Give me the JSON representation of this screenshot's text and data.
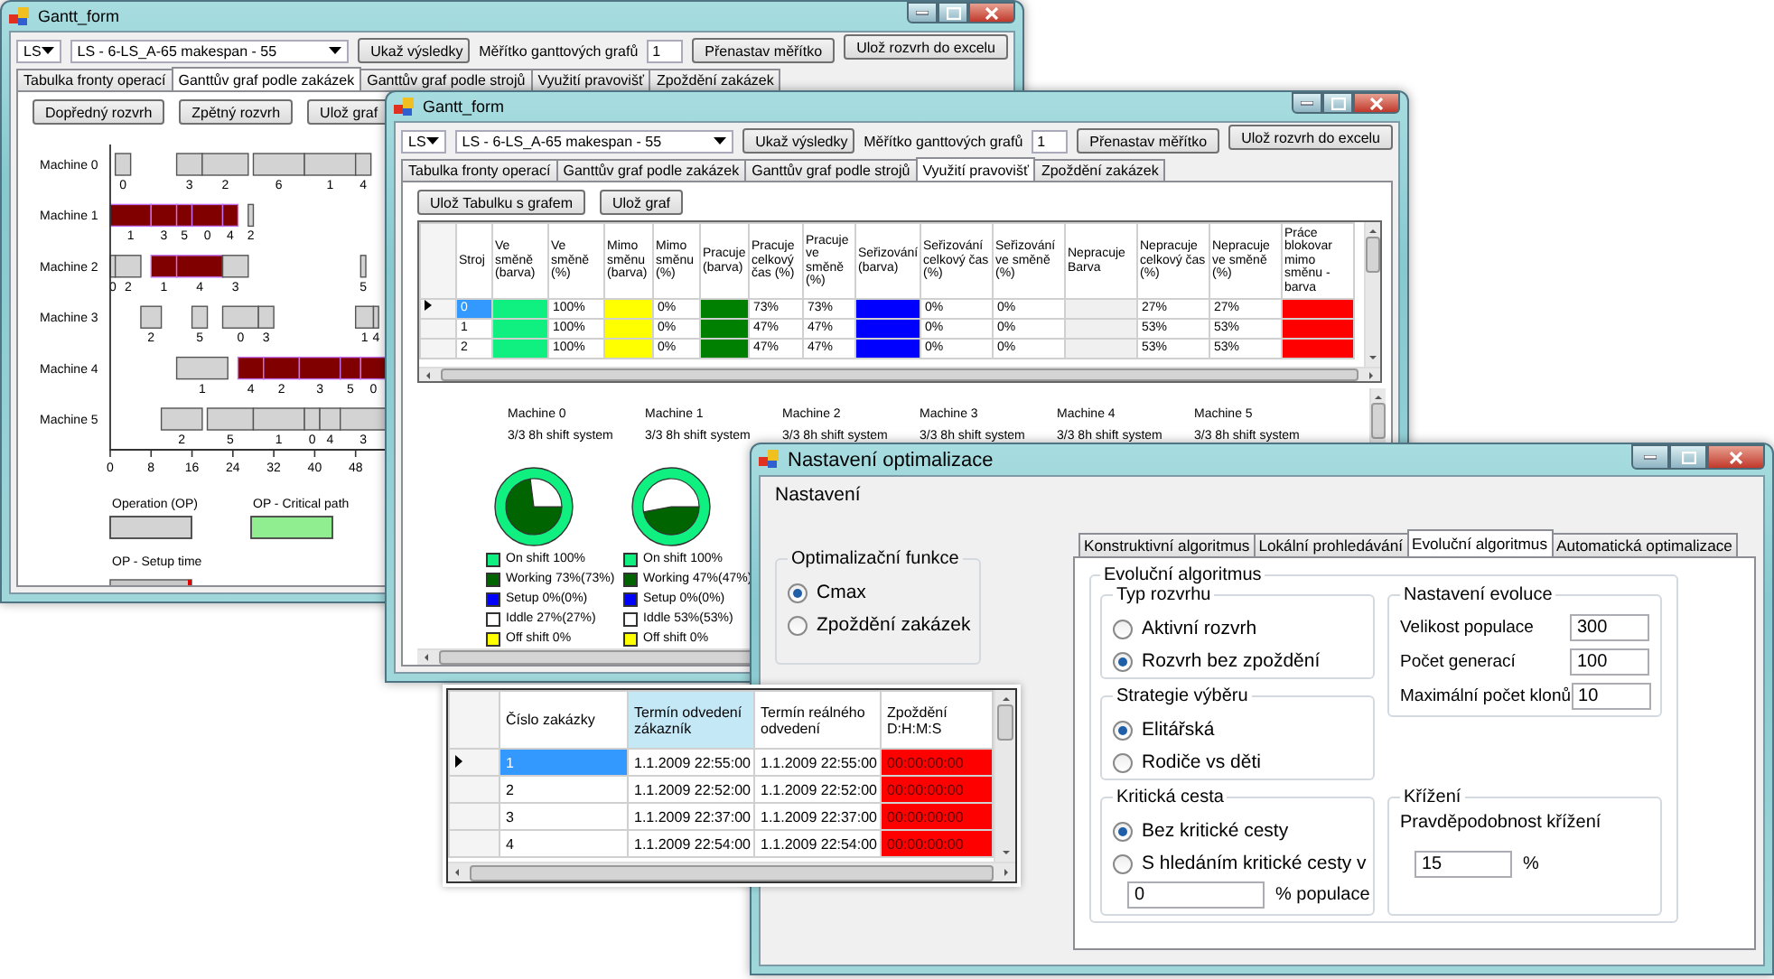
{
  "gantt_window": {
    "title": "Gantt_form",
    "algorithm_combo": "LS",
    "schedule_combo": "LS - 6-LS_A-65 makespan - 55",
    "show_results_button": "Ukaž výsledky",
    "scale_label": "Měřítko ganttových grafů",
    "scale_value": "1",
    "rescale_button": "Přenastav měřítko",
    "export_button": "Ulož rozvrh do excelu",
    "tabs": [
      {
        "label": "Tabulka fronty operací",
        "selected": false
      },
      {
        "label": "Ganttův graf podle zakázek",
        "selected": true
      },
      {
        "label": "Ganttův graf podle strojů",
        "selected": false
      },
      {
        "label": "Využití pravovišť",
        "selected": false
      },
      {
        "label": "Zpoždění zakázek",
        "selected": false
      }
    ],
    "buttons": [
      "Dopředný rozvrh",
      "Zpětný rozvrh",
      "Ulož graf"
    ],
    "gantt": {
      "ticks": [
        "0",
        "8",
        "16",
        "24",
        "32",
        "40",
        "48"
      ],
      "machines": [
        {
          "name": "Machine 0",
          "operations": [
            {
              "label": "0",
              "critical": false
            },
            {
              "label": "3",
              "critical": false
            },
            {
              "label": "2",
              "critical": false
            },
            {
              "label": "6",
              "critical": false
            },
            {
              "label": "1",
              "critical": false
            },
            {
              "label": "4",
              "critical": false
            }
          ]
        },
        {
          "name": "Machine 1",
          "operations": [
            {
              "label": "1",
              "critical": true
            },
            {
              "label": "3",
              "critical": true
            },
            {
              "label": "5",
              "critical": true
            },
            {
              "label": "0",
              "critical": true
            },
            {
              "label": "4",
              "critical": true
            },
            {
              "label": "2",
              "critical": false
            }
          ]
        },
        {
          "name": "Machine 2",
          "operations": [
            {
              "label": "0",
              "critical": false
            },
            {
              "label": "2",
              "critical": false
            },
            {
              "label": "1",
              "critical": true
            },
            {
              "label": "4",
              "critical": true
            },
            {
              "label": "3",
              "critical": false
            },
            {
              "label": "5",
              "critical": false
            }
          ]
        },
        {
          "name": "Machine 3",
          "operations": [
            {
              "label": "2",
              "critical": false
            },
            {
              "label": "5",
              "critical": false
            },
            {
              "label": "0",
              "critical": false
            },
            {
              "label": "3",
              "critical": false
            },
            {
              "label": "1",
              "critical": false
            },
            {
              "label": "4",
              "critical": false
            }
          ]
        },
        {
          "name": "Machine 4",
          "operations": [
            {
              "label": "1",
              "critical": false
            },
            {
              "label": "4",
              "critical": true
            },
            {
              "label": "2",
              "critical": true
            },
            {
              "label": "3",
              "critical": true
            },
            {
              "label": "5",
              "critical": true
            },
            {
              "label": "0",
              "critical": true
            }
          ]
        },
        {
          "name": "Machine 5",
          "operations": [
            {
              "label": "2",
              "critical": false
            },
            {
              "label": "5",
              "critical": false
            },
            {
              "label": "1",
              "critical": false
            },
            {
              "label": "0",
              "critical": false
            },
            {
              "label": "4",
              "critical": false
            },
            {
              "label": "3",
              "critical": false
            }
          ]
        }
      ],
      "legend": [
        {
          "label": "Operation (OP)",
          "kind": "operation"
        },
        {
          "label": "OP - Critical path",
          "kind": "critical"
        },
        {
          "label": "OP - Setup time",
          "kind": "setup"
        }
      ]
    }
  },
  "utilization_window": {
    "title": "Gantt_form",
    "algorithm_combo": "LS",
    "schedule_combo": "LS - 6-LS_A-65 makespan - 55",
    "show_results_button": "Ukaž výsledky",
    "scale_label": "Měřítko ganttových grafů",
    "scale_value": "1",
    "rescale_button": "Přenastav měřítko",
    "export_button": "Ulož rozvrh do excelu",
    "tabs": [
      {
        "label": "Tabulka fronty operací",
        "selected": false
      },
      {
        "label": "Ganttův graf podle zakázek",
        "selected": false
      },
      {
        "label": "Ganttův graf podle strojů",
        "selected": false
      },
      {
        "label": "Využití pravovišť",
        "selected": true
      },
      {
        "label": "Zpoždění zakázek",
        "selected": false
      }
    ],
    "buttons": [
      "Ulož Tabulku s grafem",
      "Ulož graf"
    ],
    "grid": {
      "columns": [
        {
          "label": "Stroj",
          "kind": "text"
        },
        {
          "label": "Ve směně (barva)",
          "kind": "color"
        },
        {
          "label": "Ve směně (%)",
          "kind": "text"
        },
        {
          "label": "Mimo směnu (barva)",
          "kind": "color"
        },
        {
          "label": "Mimo směnu (%)",
          "kind": "text"
        },
        {
          "label": "Pracuje (barva)",
          "kind": "color"
        },
        {
          "label": "Pracuje celkový čas (%)",
          "kind": "text"
        },
        {
          "label": "Pracuje ve směně (%)",
          "kind": "text"
        },
        {
          "label": "Seřizování (barva)",
          "kind": "color"
        },
        {
          "label": "Seřizování celkový čas (%)",
          "kind": "text"
        },
        {
          "label": "Seřizování ve směně (%)",
          "kind": "text"
        },
        {
          "label": "Nepracuje Barva",
          "kind": "color"
        },
        {
          "label": "Nepracuje celkový čas (%)",
          "kind": "text"
        },
        {
          "label": "Nepracuje ve směně (%)",
          "kind": "text"
        },
        {
          "label": "Práce blokovar mimo směnu - barva",
          "kind": "color"
        }
      ],
      "rows": [
        {
          "selected": true,
          "cells": [
            "0",
            {
              "color": "#10f080"
            },
            "100%",
            {
              "color": "#ffff00"
            },
            "0%",
            {
              "color": "#008000"
            },
            "73%",
            "73%",
            {
              "color": "#0000ff"
            },
            "0%",
            "0%",
            {
              "color": "#f0f0f0"
            },
            "27%",
            "27%",
            {
              "color": "#ff0000"
            }
          ]
        },
        {
          "selected": false,
          "cells": [
            "1",
            {
              "color": "#10f080"
            },
            "100%",
            {
              "color": "#ffff00"
            },
            "0%",
            {
              "color": "#008000"
            },
            "47%",
            "47%",
            {
              "color": "#0000ff"
            },
            "0%",
            "0%",
            {
              "color": "#f0f0f0"
            },
            "53%",
            "53%",
            {
              "color": "#ff0000"
            }
          ]
        },
        {
          "selected": false,
          "cells": [
            "2",
            {
              "color": "#10f080"
            },
            "100%",
            {
              "color": "#ffff00"
            },
            "0%",
            {
              "color": "#008000"
            },
            "47%",
            "47%",
            {
              "color": "#0000ff"
            },
            "0%",
            "0%",
            {
              "color": "#f0f0f0"
            },
            "53%",
            "53%",
            {
              "color": "#ff0000"
            }
          ]
        }
      ]
    },
    "machines": [
      {
        "name": "Machine 0",
        "shift": "3/3 8h shift system",
        "pie": {
          "chart_data": {
            "type": "pie",
            "values": [
              73,
              27
            ]
          },
          "legend": [
            {
              "label": "On shift 100%",
              "color": "#10f080"
            },
            {
              "label": "Working 73%(73%)",
              "color": "#006400"
            },
            {
              "label": "Setup 0%(0%)",
              "color": "#0000ff"
            },
            {
              "label": "Iddle 27%(27%)",
              "color": "#ffffff"
            },
            {
              "label": "Off shift 0%",
              "color": "#ffff00"
            }
          ]
        }
      },
      {
        "name": "Machine 1",
        "shift": "3/3 8h shift system",
        "pie": {
          "chart_data": {
            "type": "pie",
            "values": [
              47,
              53
            ]
          },
          "legend": [
            {
              "label": "On shift 100%",
              "color": "#10f080"
            },
            {
              "label": "Working 47%(47%)",
              "color": "#006400"
            },
            {
              "label": "Setup 0%(0%)",
              "color": "#0000ff"
            },
            {
              "label": "Iddle 53%(53%)",
              "color": "#ffffff"
            },
            {
              "label": "Off shift 0%",
              "color": "#ffff00"
            }
          ]
        }
      },
      {
        "name": "Machine 2",
        "shift": "3/3 8h shift system"
      },
      {
        "name": "Machine 3",
        "shift": "3/3 8h shift system"
      },
      {
        "name": "Machine 4",
        "shift": "3/3 8h shift system"
      },
      {
        "name": "Machine 5",
        "shift": "3/3 8h shift system"
      }
    ]
  },
  "optimization_window": {
    "title": "Nastavení optimalizace",
    "menu": [
      "Nastavení"
    ],
    "objective_group": {
      "title": "Optimalizační funkce",
      "options": [
        {
          "label": "Cmax",
          "selected": true
        },
        {
          "label": "Zpoždění zakázek",
          "selected": false
        }
      ]
    },
    "tabs": [
      {
        "label": "Konstruktivní algoritmus",
        "selected": false
      },
      {
        "label": "Lokální prohledávání",
        "selected": false
      },
      {
        "label": "Evoluční algoritmus",
        "selected": true
      },
      {
        "label": "Automatická optimalizace",
        "selected": false
      }
    ],
    "algorithm_group": {
      "title": "Evoluční algoritmus",
      "schedule_type": {
        "title": "Typ rozvrhu",
        "options": [
          {
            "label": "Aktivní rozvrh",
            "selected": false
          },
          {
            "label": "Rozvrh bez zpoždění",
            "selected": true
          }
        ]
      },
      "selection_strategy": {
        "title": "Strategie výběru",
        "options": [
          {
            "label": "Elitářská",
            "selected": true
          },
          {
            "label": "Rodiče vs děti",
            "selected": false
          }
        ]
      },
      "critical_path": {
        "title": "Kritická cesta",
        "options": [
          {
            "label": "Bez kritické cesty",
            "selected": true
          },
          {
            "label": "S hledáním kritické cesty v",
            "selected": false
          }
        ],
        "population_value": "0",
        "population_unit": "% populace"
      },
      "evolution_settings": {
        "title": "Nastavení evoluce",
        "fields": [
          {
            "label": "Velikost populace",
            "value": "300"
          },
          {
            "label": "Počet generací",
            "value": "100"
          },
          {
            "label": "Maximální počet klonů",
            "value": "10"
          }
        ]
      },
      "crossover": {
        "title": "Křížení",
        "label": "Pravděpodobnost křížení",
        "value": "15",
        "unit": "%"
      }
    }
  },
  "orders_table": {
    "columns": [
      {
        "label": "Číslo zakázky",
        "kind": "text",
        "selected": false
      },
      {
        "label": "Termín odvedení zákazník",
        "kind": "text",
        "selected": true
      },
      {
        "label": "Termín reálného odvedení",
        "kind": "text",
        "selected": false
      },
      {
        "label": "Zpoždění D:H:M:S",
        "kind": "delay",
        "selected": false
      }
    ],
    "rows": [
      {
        "selected": true,
        "cells": [
          "1",
          "1.1.2009 22:55:00",
          "1.1.2009 22:55:00",
          "00:00:00:00"
        ]
      },
      {
        "selected": false,
        "cells": [
          "2",
          "1.1.2009 22:52:00",
          "1.1.2009 22:52:00",
          "00:00:00:00"
        ]
      },
      {
        "selected": false,
        "cells": [
          "3",
          "1.1.2009 22:37:00",
          "1.1.2009 22:37:00",
          "00:00:00:00"
        ]
      },
      {
        "selected": false,
        "cells": [
          "4",
          "1.1.2009 22:54:00",
          "1.1.2009 22:54:00",
          "00:00:00:00"
        ]
      }
    ]
  }
}
